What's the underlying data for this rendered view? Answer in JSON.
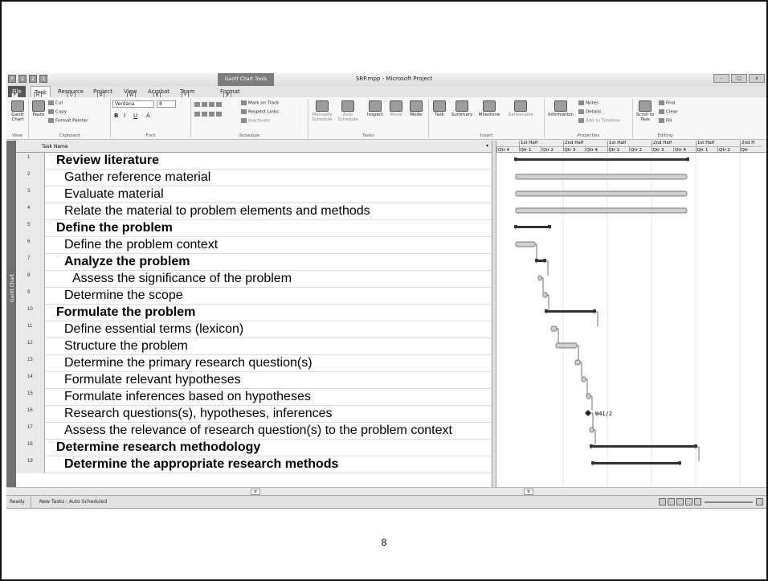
{
  "window": {
    "title": "SRP.mpp - Microsoft Project",
    "contextual_tab": "Gantt Chart Tools"
  },
  "tabs": [
    {
      "label": "File",
      "keytip": "F"
    },
    {
      "label": "Task",
      "keytip": "H"
    },
    {
      "label": "Resource",
      "keytip": "U"
    },
    {
      "label": "Project",
      "keytip": "R"
    },
    {
      "label": "View",
      "keytip": "W"
    },
    {
      "label": "Acrobat",
      "keytip": "B"
    },
    {
      "label": "Team",
      "keytip": "Y"
    },
    {
      "label": "Format",
      "keytip": "JF"
    }
  ],
  "ribbon": {
    "view": {
      "gantt_label": "Gantt Chart",
      "group": "View"
    },
    "clipboard": {
      "paste": "Paste",
      "cut": "Cut",
      "copy": "Copy",
      "format_painter": "Format Painter",
      "group": "Clipboard"
    },
    "font": {
      "name": "Verdana",
      "size": "8",
      "group": "Font"
    },
    "schedule": {
      "mark_on_track": "Mark on Track",
      "respect_links": "Respect Links",
      "inactivate": "Inactivate",
      "group": "Schedule"
    },
    "tasks": {
      "manually": "Manually Schedule",
      "auto": "Auto Schedule",
      "inspect": "Inspect",
      "move": "Move",
      "mode": "Mode",
      "group": "Tasks"
    },
    "insert": {
      "task": "Task",
      "summary": "Summary",
      "milestone": "Milestone",
      "deliverable": "Deliverable",
      "group": "Insert"
    },
    "properties": {
      "information": "Information",
      "notes": "Notes",
      "details": "Details",
      "add_timeline": "Add to Timeline",
      "group": "Properties"
    },
    "editing": {
      "scroll": "Scroll to Task",
      "find": "Find",
      "clear": "Clear",
      "fill": "Fill",
      "group": "Editing"
    }
  },
  "sheet": {
    "column_header": "Task Name",
    "view_label": "Gantt Chart",
    "rows": [
      {
        "id": "1",
        "name": "Review literature",
        "level": 0,
        "summary": true
      },
      {
        "id": "2",
        "name": "Gather reference material",
        "level": 1,
        "summary": false
      },
      {
        "id": "3",
        "name": "Evaluate material",
        "level": 1,
        "summary": false
      },
      {
        "id": "4",
        "name": "Relate the material to problem elements and methods",
        "level": 1,
        "summary": false
      },
      {
        "id": "5",
        "name": "Define the problem",
        "level": 0,
        "summary": true
      },
      {
        "id": "6",
        "name": "Define the problem context",
        "level": 1,
        "summary": false
      },
      {
        "id": "7",
        "name": "Analyze the problem",
        "level": 1,
        "summary": true
      },
      {
        "id": "8",
        "name": "Assess the significance of the problem",
        "level": 2,
        "summary": false
      },
      {
        "id": "9",
        "name": "Determine the scope",
        "level": 1,
        "summary": false
      },
      {
        "id": "10",
        "name": "Formulate the problem",
        "level": 0,
        "summary": true
      },
      {
        "id": "11",
        "name": "Define essential terms (lexicon)",
        "level": 1,
        "summary": false
      },
      {
        "id": "12",
        "name": "Structure the problem",
        "level": 1,
        "summary": false
      },
      {
        "id": "13",
        "name": "Determine the primary research question(s)",
        "level": 1,
        "summary": false
      },
      {
        "id": "14",
        "name": "Formulate relevant hypotheses",
        "level": 1,
        "summary": false
      },
      {
        "id": "15",
        "name": "Formulate inferences based on hypotheses",
        "level": 1,
        "summary": false
      },
      {
        "id": "16",
        "name": "Research questions(s), hypotheses, inferences",
        "level": 1,
        "summary": false
      },
      {
        "id": "17",
        "name": "Assess the relevance of research question(s) to the problem context",
        "level": 1,
        "summary": false
      },
      {
        "id": "18",
        "name": "Determine research methodology",
        "level": 0,
        "summary": true
      },
      {
        "id": "19",
        "name": "Determine the appropriate research methods",
        "level": 1,
        "summary": true
      }
    ]
  },
  "timescale": {
    "top": [
      "1st Half",
      "2nd Half",
      "1st Half",
      "2nd Half",
      "1st Half",
      "2nd H"
    ],
    "bottom": [
      "Qtr 4",
      "Qtr 1",
      "Qtr 2",
      "Qtr 3",
      "Qtr 4",
      "Qtr 1",
      "Qtr 2",
      "Qtr 3",
      "Qtr 4",
      "Qtr 1",
      "Qtr 2",
      "Qtr"
    ]
  },
  "gantt": {
    "milestone_label": "W41/2",
    "bar_color": "#d0d0d0",
    "summary_color": "#333333"
  },
  "status": {
    "ready": "Ready",
    "new_tasks": "New Tasks : Auto Scheduled"
  },
  "page_number": "8"
}
